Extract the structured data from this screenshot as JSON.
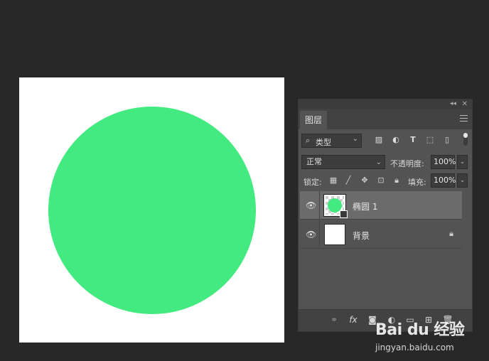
{
  "document": {
    "shape_color": "#43ea7f",
    "background_color": "#ffffff"
  },
  "layers_panel": {
    "tab_title": "图层",
    "filter": {
      "kind_label": "类型",
      "search_icon": "magnifier-icon"
    },
    "blend_mode": "正常",
    "opacity_label": "不透明度:",
    "opacity_value": "100%",
    "lock_label": "锁定:",
    "fill_label": "填充:",
    "fill_value": "100%",
    "layers": [
      {
        "name": "椭圆 1",
        "selected": true,
        "visible": true
      },
      {
        "name": "背景",
        "selected": false,
        "visible": true,
        "locked": true
      }
    ]
  },
  "watermark": {
    "logo": "Bai du 经验",
    "url": "jingyan.baidu.com"
  }
}
